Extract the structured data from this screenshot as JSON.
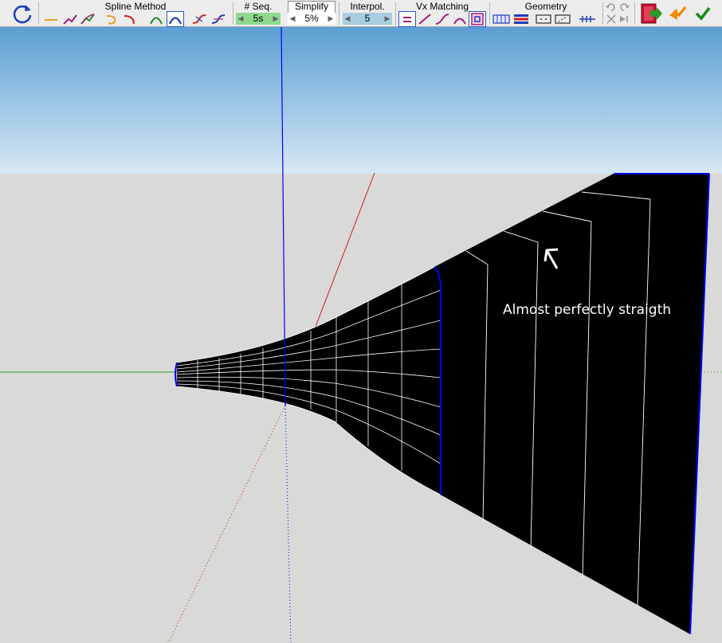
{
  "toolbar": {
    "spline_method": {
      "label": "Spline Method"
    },
    "seq": {
      "label": "# Seq.",
      "value": "5s"
    },
    "simplify": {
      "label": "Simplify",
      "value": "5%"
    },
    "interpol": {
      "label": "Interpol.",
      "value": "5"
    },
    "vx_matching": {
      "label": "Vx Matching"
    },
    "geometry": {
      "label": "Geometry"
    }
  },
  "colors": {
    "sky_top": "#5b9fd3",
    "sky_bottom": "#d8e8f4",
    "ground": "#d9d9d7",
    "mesh_fill": "#000000",
    "mesh_line": "#ffffff",
    "edge_highlight": "#0000ff",
    "seq_green": "#8fd98f",
    "interpol_blue": "#a9cde0"
  },
  "viewport": {
    "annotation": "Almost perfectly straigth"
  }
}
